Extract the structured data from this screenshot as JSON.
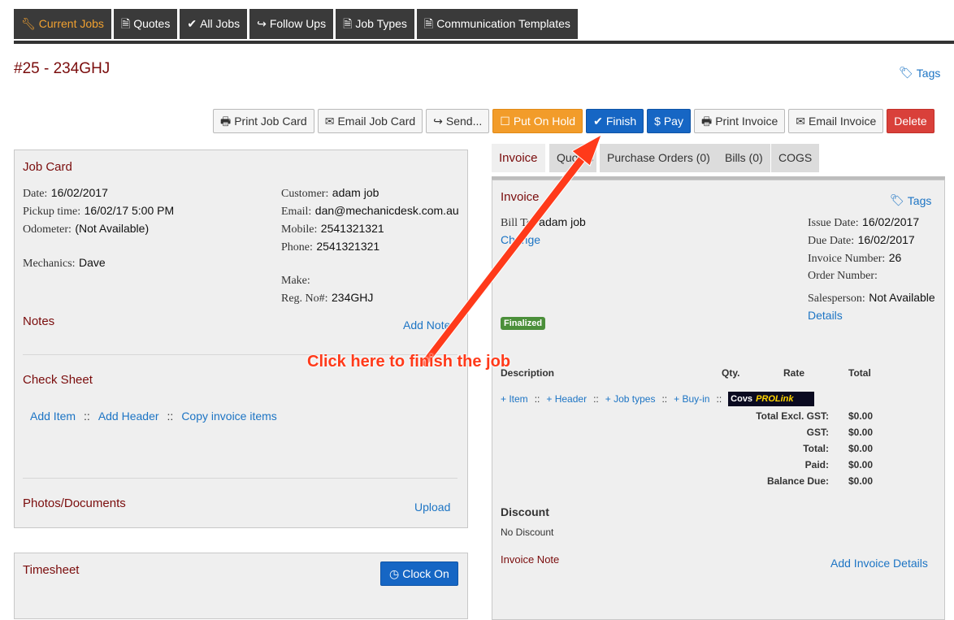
{
  "nav": {
    "tabs": [
      {
        "label": "Current Jobs",
        "icon": "wrench-icon"
      },
      {
        "label": "Quotes",
        "icon": "document-icon"
      },
      {
        "label": "All Jobs",
        "icon": "check-icon"
      },
      {
        "label": "Follow Ups",
        "icon": "share-arrow-icon"
      },
      {
        "label": "Job Types",
        "icon": "document-icon"
      },
      {
        "label": "Communication Templates",
        "icon": "document-icon"
      }
    ]
  },
  "job": {
    "title": "#25 - 234GHJ",
    "tags_label": "Tags"
  },
  "actions": {
    "print_job_card": "Print Job Card",
    "email_job_card": "Email Job Card",
    "send": "Send...",
    "put_on_hold": "Put On Hold",
    "finish": "Finish",
    "pay": "$ Pay",
    "print_invoice": "Print Invoice",
    "email_invoice": "Email Invoice",
    "delete": "Delete"
  },
  "job_card": {
    "title": "Job Card",
    "date_label": "Date:",
    "date": "16/02/2017",
    "pickup_label": "Pickup time:",
    "pickup": "16/02/17 5:00 PM",
    "odometer_label": "Odometer:",
    "odometer": "(Not Available)",
    "mechanics_label": "Mechanics:",
    "mechanics": "Dave",
    "customer_label": "Customer:",
    "customer": "adam job",
    "email_label": "Email:",
    "email": "dan@mechanicdesk.com.au",
    "mobile_label": "Mobile:",
    "mobile": "2541321321",
    "phone_label": "Phone:",
    "phone": "2541321321",
    "make_label": "Make:",
    "reg_label": "Reg. No#:",
    "reg": "234GHJ",
    "notes_title": "Notes",
    "add_note": "Add Note",
    "check_sheet_title": "Check Sheet",
    "add_item": "Add Item",
    "add_header": "Add Header",
    "copy_invoice_items": "Copy invoice items",
    "sep": "::",
    "photos_title": "Photos/Documents",
    "upload": "Upload"
  },
  "timesheet": {
    "title": "Timesheet",
    "clock_on": "Clock On"
  },
  "right_tabs": [
    {
      "label": "Invoice"
    },
    {
      "label": "Quotes"
    },
    {
      "label": "Purchase Orders (0)"
    },
    {
      "label": "Bills (0)"
    },
    {
      "label": "COGS"
    }
  ],
  "invoice": {
    "title": "Invoice",
    "tags_label": "Tags",
    "bill_to_label": "Bill To:",
    "bill_to": "adam job",
    "change": "Change",
    "issue_date_label": "Issue Date:",
    "issue_date": "16/02/2017",
    "due_date_label": "Due Date:",
    "due_date": "16/02/2017",
    "invoice_number_label": "Invoice Number:",
    "invoice_number": "26",
    "order_number_label": "Order Number:",
    "salesperson_label": "Salesperson:",
    "salesperson": "Not Available",
    "details": "Details",
    "status_badge": "Finalized",
    "col_description": "Description",
    "col_qty": "Qty.",
    "col_rate": "Rate",
    "col_total": "Total",
    "add_item": "+ Item",
    "add_header": "+ Header",
    "add_job_types": "+ Job types",
    "add_buy_in": "+ Buy-in",
    "sep": "::",
    "prolink_a": "Covs",
    "prolink_b": "PROLink",
    "totals": [
      {
        "label": "Total Excl. GST:",
        "value": "$0.00"
      },
      {
        "label": "GST:",
        "value": "$0.00"
      },
      {
        "label": "Total:",
        "value": "$0.00"
      },
      {
        "label": "Paid:",
        "value": "$0.00"
      },
      {
        "label": "Balance Due:",
        "value": "$0.00"
      }
    ],
    "discount_title": "Discount",
    "discount_value": "No Discount",
    "note_title": "Invoice Note",
    "add_details": "Add Invoice Details"
  },
  "annotation": {
    "text": "Click here to finish the job",
    "color": "#ff3a1a"
  }
}
